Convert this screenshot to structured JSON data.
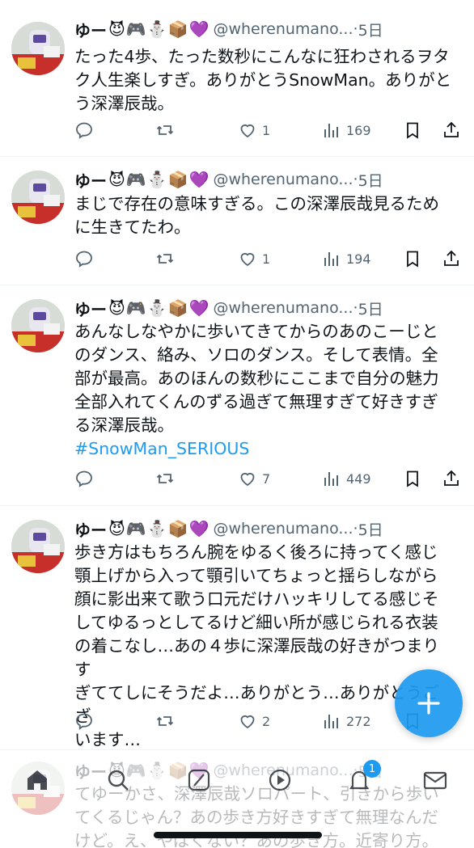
{
  "author": {
    "name": "ゆー",
    "emojis": "😈🎮⛄📦💜",
    "handle": "@wherenumano...",
    "separator": " · "
  },
  "tweets": [
    {
      "time": "5日",
      "text": "たった4歩、たった数秒にこんなに狂わされるヲタ\nク人生楽しすぎ。ありがとうSnowMan。ありがと\nう深澤辰哉。",
      "hashtag": "",
      "likes": "1",
      "views": "169"
    },
    {
      "time": "5日",
      "text": "まじで存在の意味すぎる。この深澤辰哉見るため\nに生きてたわ。",
      "hashtag": "",
      "likes": "1",
      "views": "194"
    },
    {
      "time": "5日",
      "text": "あんなしなやかに歩いてきてからのあのこーじと\nのダンス、絡み、ソロのダンス。そして表情。全\n部が最高。あのほんの数秒にここまで自分の魅力\n全部入れてくんのずる過ぎて無理すぎて好きすぎ\nる深澤辰哉。",
      "hashtag": "#SnowMan_SERIOUS",
      "likes": "7",
      "views": "449"
    },
    {
      "time": "5日",
      "text": "歩き方はもちろん腕をゆるく後ろに持ってく感じ\n顎上げから入って顎引いてちょっと揺らしながら\n顔に影出来て歌う口元だけハッキリしてる感じそ\nしてゆるっとしてるけど細い所が感じられる衣装\nの着こなし…あの４歩に深澤辰哉の好きがつまりす\nぎててしにそうだよ…ありがとう…ありがとうござ\nいます…",
      "hashtag": "",
      "likes": "2",
      "views": "272"
    },
    {
      "time": "5日",
      "text": "てゆーかさ、深澤辰哉ソロパート、引きから歩い\nてくるじゃん？あの歩き方好きすぎて無理なんだ\nけど。え、やばくない？あの歩き方。近寄り方。",
      "hashtag": "",
      "likes": "",
      "views": ""
    }
  ],
  "fab": {
    "icon": "compose-plus-icon"
  },
  "nav": {
    "notification_count": "1"
  },
  "colors": {
    "accent": "#1d9bf0",
    "text": "#0f1419",
    "muted": "#536471"
  }
}
